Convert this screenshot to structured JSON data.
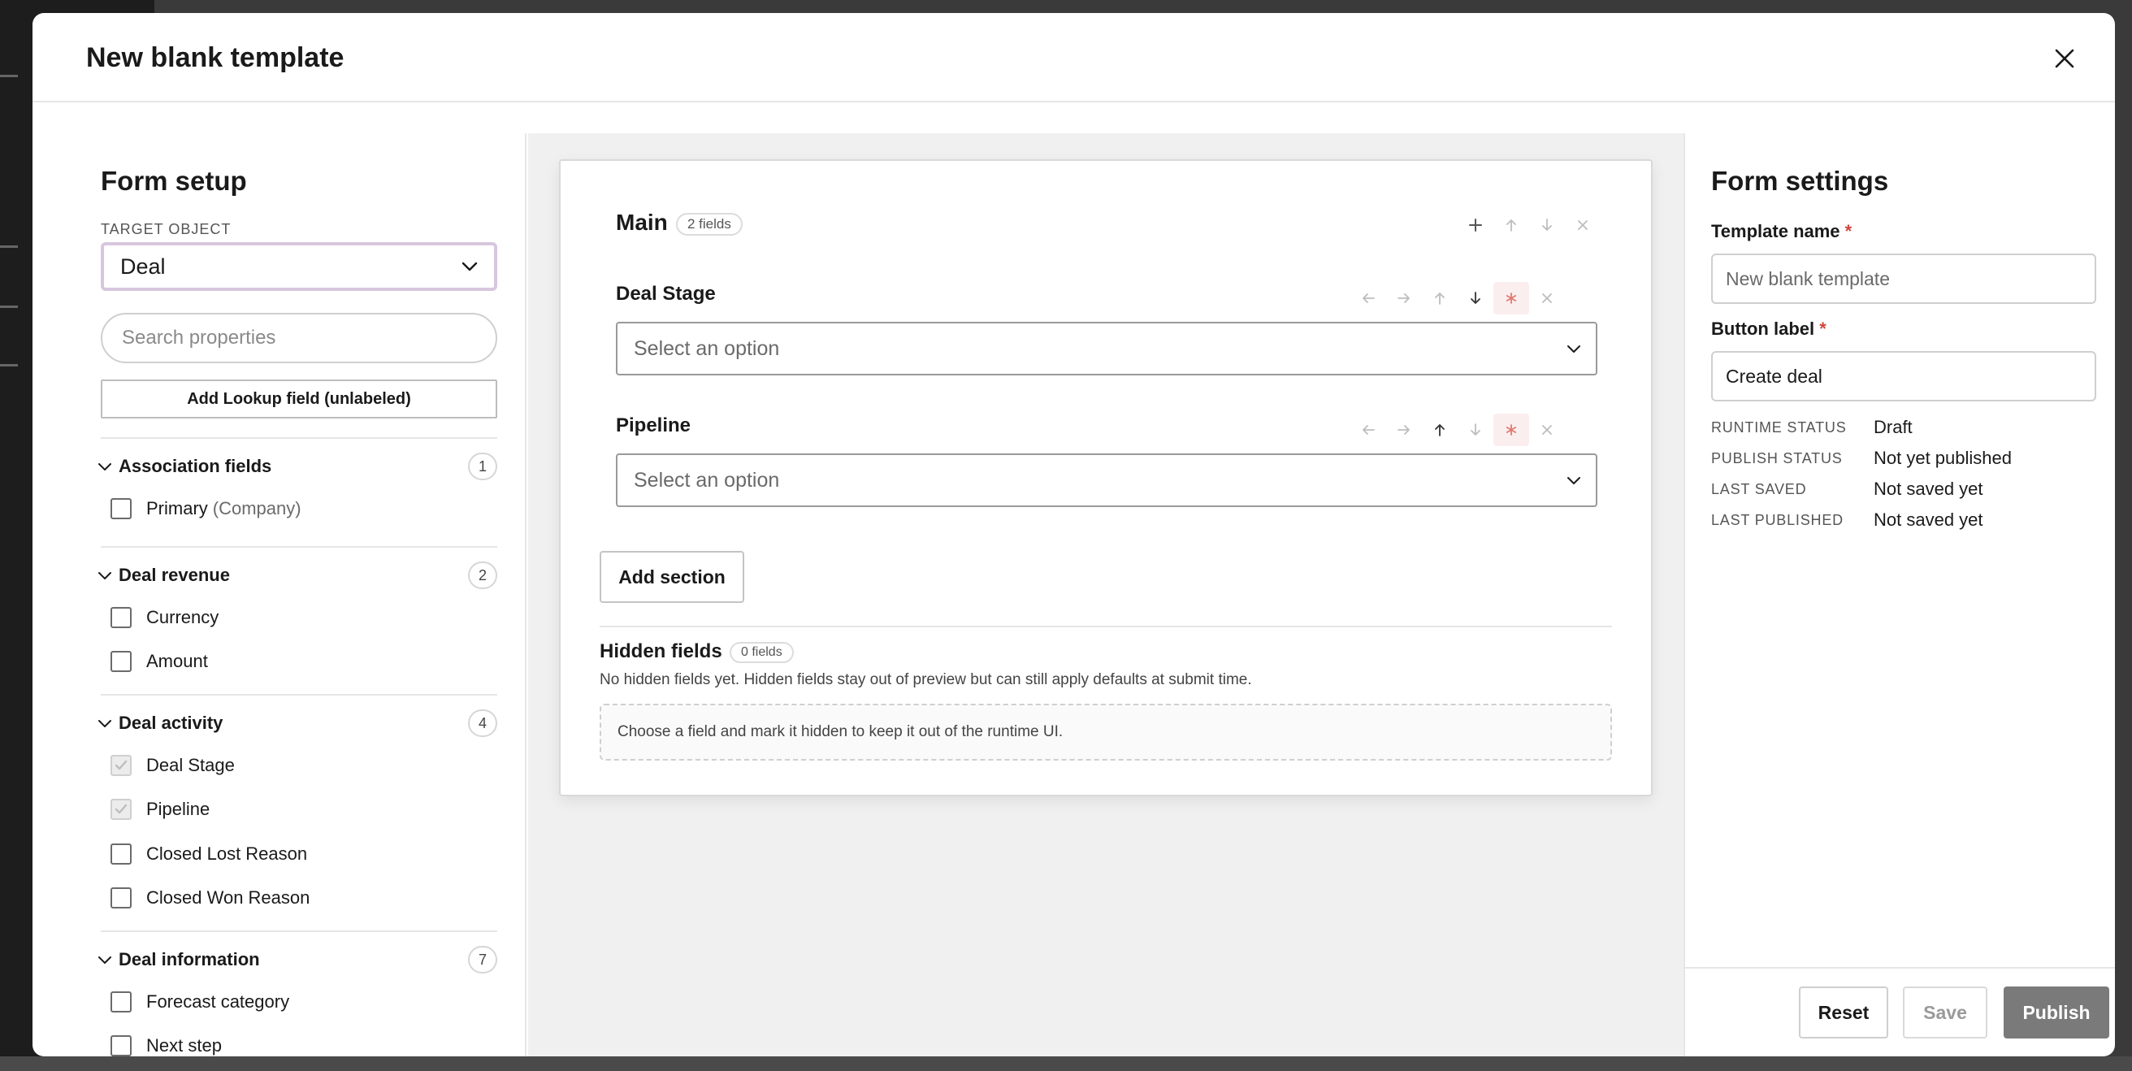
{
  "modal": {
    "title": "New blank template"
  },
  "form_setup": {
    "title": "Form setup",
    "target_object_label": "TARGET OBJECT",
    "target_object_value": "Deal",
    "search_placeholder": "Search properties",
    "lookup_button": "Add Lookup field (unlabeled)",
    "groups": [
      {
        "label": "Association fields",
        "count": "1",
        "items": [
          {
            "label": "Primary",
            "suffix": "(Company)",
            "checked": false
          }
        ]
      },
      {
        "label": "Deal revenue",
        "count": "2",
        "items": [
          {
            "label": "Currency",
            "checked": false
          },
          {
            "label": "Amount",
            "checked": false
          }
        ]
      },
      {
        "label": "Deal activity",
        "count": "4",
        "items": [
          {
            "label": "Deal Stage",
            "checked": true
          },
          {
            "label": "Pipeline",
            "checked": true
          },
          {
            "label": "Closed Lost Reason",
            "checked": false
          },
          {
            "label": "Closed Won Reason",
            "checked": false
          }
        ]
      },
      {
        "label": "Deal information",
        "count": "7",
        "items": [
          {
            "label": "Forecast category",
            "checked": false
          },
          {
            "label": "Next step",
            "checked": false
          }
        ]
      }
    ]
  },
  "canvas": {
    "section": {
      "title": "Main",
      "field_count": "2 fields"
    },
    "fields": [
      {
        "label": "Deal Stage",
        "placeholder": "Select an option"
      },
      {
        "label": "Pipeline",
        "placeholder": "Select an option"
      }
    ],
    "add_section_button": "Add section",
    "hidden": {
      "title": "Hidden fields",
      "count": "0 fields",
      "description": "No hidden fields yet. Hidden fields stay out of preview but can still apply defaults at submit time.",
      "dropzone": "Choose a field and mark it hidden to keep it out of the runtime UI."
    }
  },
  "form_settings": {
    "title": "Form settings",
    "template_name_label": "Template name",
    "template_name_placeholder": "New blank template",
    "button_label_label": "Button label",
    "button_label_value": "Create deal",
    "required_marker": "*",
    "status": [
      {
        "key": "RUNTIME STATUS",
        "value": "Draft"
      },
      {
        "key": "PUBLISH STATUS",
        "value": "Not yet published"
      },
      {
        "key": "LAST SAVED",
        "value": "Not saved yet"
      },
      {
        "key": "LAST PUBLISHED",
        "value": "Not saved yet"
      }
    ],
    "buttons": {
      "reset": "Reset",
      "save": "Save",
      "publish": "Publish"
    }
  },
  "colors": {
    "required_star": "#d0463b",
    "publish_bg": "#7a7a7a",
    "target_select_border": "#d8c6de"
  }
}
